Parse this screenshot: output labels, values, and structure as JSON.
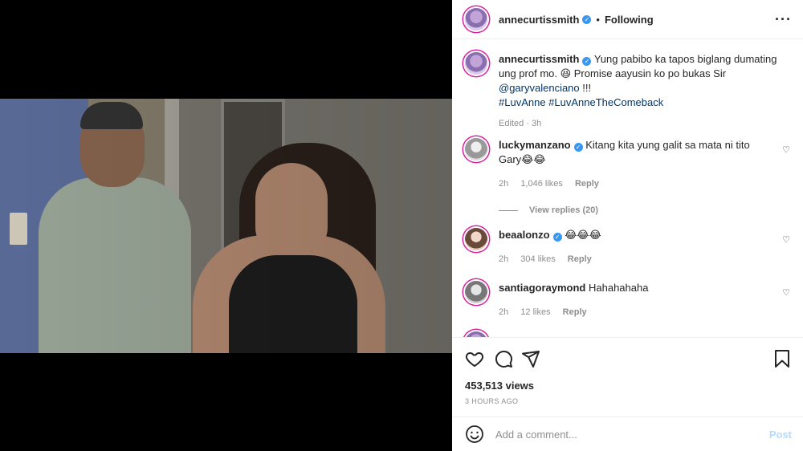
{
  "post": {
    "author": "annecurtissmith",
    "follow_label": "Following",
    "more_icon": "more-horizontal-icon"
  },
  "caption": {
    "username": "annecurtissmith",
    "text_1": "Yung pabibo ka tapos biglang dumating ung prof mo. 😆 Promise aayusin ko po bukas Sir ",
    "mention": "@garyvalenciano",
    "text_2": " !!!",
    "hashtags": "#LuvAnne #LuvAnneTheComeback",
    "edited": "Edited · 3h"
  },
  "comments": [
    {
      "username": "luckymanzano",
      "verified": true,
      "text": "Kitang kita yung galit sa mata ni tito Gary😂😂",
      "time": "2h",
      "likes": "1,046 likes",
      "reply": "Reply",
      "view_replies": "View replies (20)"
    },
    {
      "username": "beaalonzo",
      "verified": true,
      "text": "😂😂😂",
      "time": "2h",
      "likes": "304 likes",
      "reply": "Reply"
    },
    {
      "username": "santiagoraymond",
      "verified": false,
      "text": "Hahahahaha",
      "time": "2h",
      "likes": "12 likes",
      "reply": "Reply"
    }
  ],
  "stats": {
    "views": "453,513 views",
    "posted": "3 HOURS AGO"
  },
  "add_comment": {
    "placeholder": "Add a comment...",
    "post_label": "Post"
  },
  "colors": {
    "verified": "#3897f0",
    "muted": "#8e8e8e",
    "link": "#00376b",
    "post_disabled": "#b3dbff"
  }
}
